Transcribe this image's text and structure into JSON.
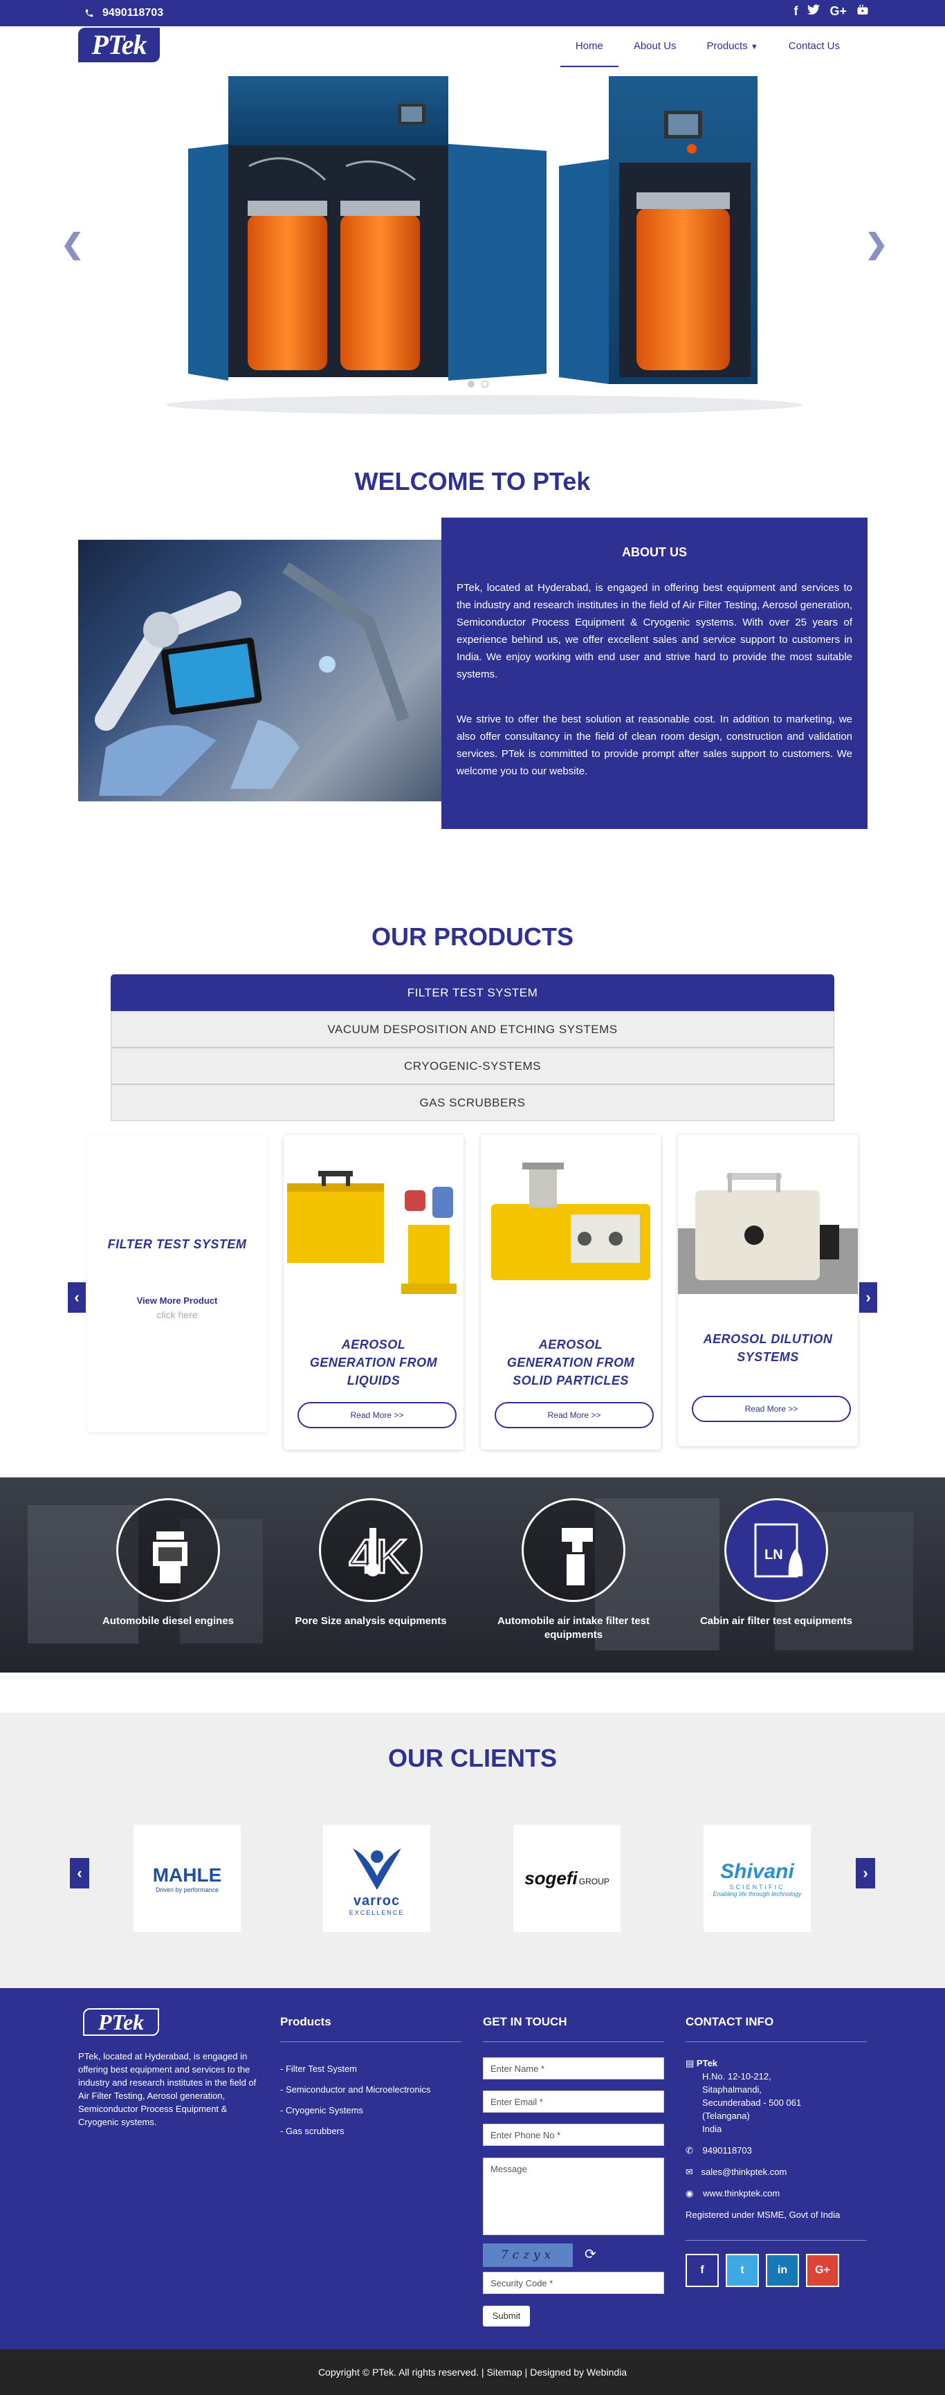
{
  "topbar": {
    "phone": "9490118703",
    "social": [
      "f",
      "t",
      "G+",
      "yt"
    ]
  },
  "header": {
    "logo": "PTek",
    "nav": [
      {
        "label": "Home"
      },
      {
        "label": "About Us"
      },
      {
        "label": "Products"
      },
      {
        "label": "Contact Us"
      }
    ]
  },
  "welcome": {
    "title": "WELCOME TO PTek"
  },
  "about": {
    "title": "ABOUT US",
    "p1": "PTek, located at Hyderabad, is engaged in offering best equipment and services to the industry and research institutes in the field of Air Filter Testing, Aerosol generation, Semiconductor Process Equipment & Cryogenic systems. With over 25 years of experience behind us, we offer excellent sales and service support to customers in India. We enjoy working with end user and strive hard to provide the most suitable systems.",
    "p2": "We strive to offer the best solution at reasonable cost. In addition to marketing, we also offer consultancy in the field of clean room design, construction and validation services. PTek is committed to provide prompt after sales support to customers. We welcome you to our website."
  },
  "products": {
    "title": "OUR PRODUCTS",
    "tabs": [
      "FILTER TEST SYSTEM",
      "VACUUM DESPOSITION AND ETCHING SYSTEMS",
      "CRYOGENIC-SYSTEMS",
      "GAS SCRUBBERS"
    ],
    "card0": {
      "title": "FILTER TEST SYSTEM",
      "view": "View More Product",
      "click": "click here"
    },
    "cards": [
      {
        "title": "AEROSOL GENERATION FROM LIQUIDS",
        "btn": "Read More >>"
      },
      {
        "title": "AEROSOL GENERATION FROM SOLID PARTICLES",
        "btn": "Read More >>"
      },
      {
        "title": "AEROSOL DILUTION SYSTEMS",
        "btn": "Read More >>"
      }
    ]
  },
  "apps": [
    {
      "label": "Automobile diesel engines"
    },
    {
      "label": "Pore Size analysis equipments"
    },
    {
      "label": "Automobile air intake filter test equipments"
    },
    {
      "label": "Cabin air filter test equipments"
    }
  ],
  "clients": {
    "title": "OUR CLIENTS",
    "logos": [
      {
        "name": "MAHLE",
        "tag": "Driven by performance"
      },
      {
        "name": "varroc",
        "tag": "EXCELLENCE"
      },
      {
        "name": "sogefi",
        "tag": "GROUP"
      },
      {
        "name": "Shivani",
        "tag": "SCIENTIFIC",
        "tag2": "Enabling life through technology"
      }
    ]
  },
  "footer": {
    "logo": "PTek",
    "about": "PTek, located at Hyderabad, is engaged in offering best equipment and services to the industry and research institutes in the field of Air Filter Testing, Aerosol generation, Semiconductor Process Equipment & Cryogenic systems.",
    "products_title": "Products",
    "products": [
      "- Filter Test System",
      "- Semiconductor and Microelectronics",
      "- Cryogenic Systems",
      "- Gas scrubbers"
    ],
    "touch_title": "GET IN TOUCH",
    "name_ph": "Enter Name *",
    "email_ph": "Enter Email *",
    "phone_ph": "Enter Phone No *",
    "msg_ph": "Message",
    "captcha": "7czyx",
    "code_ph": "Security Code *",
    "submit": "Submit",
    "contact_title": "CONTACT INFO",
    "company": "PTek",
    "addr1": "H.No. 12-10-212,",
    "addr2": "Sitaphalmandi,",
    "addr3": "Secunderabad - 500 061",
    "addr4": "(Telangana)",
    "addr5": "India",
    "phone": "9490118703",
    "email": "sales@thinkptek.com",
    "web": "www.thinkptek.com",
    "msme": "Registered under MSME, Govt of India",
    "social": [
      "f",
      "t",
      "in",
      "G+"
    ]
  },
  "copyright": {
    "text": "Copyright © PTek. All rights reserved.",
    "sitemap": "Sitemap",
    "designed": "Designed by Webindia"
  },
  "colors": {
    "brand": "#2e3192",
    "dark": "#252525"
  }
}
